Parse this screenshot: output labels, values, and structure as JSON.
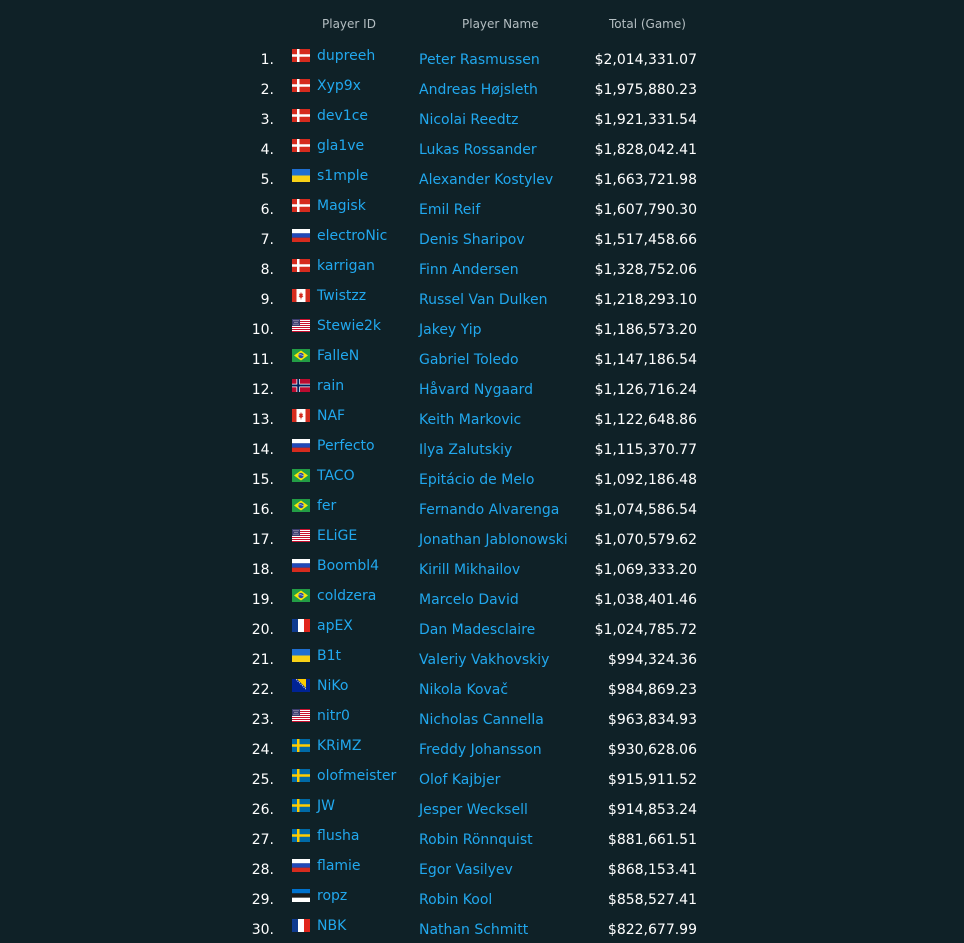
{
  "headers": {
    "player_id": "Player ID",
    "player_name": "Player Name",
    "total": "Total (Game)"
  },
  "colors": {
    "background": "#0f2127",
    "link": "#21a8ee",
    "text": "#ffffff",
    "header": "#b4bec2"
  },
  "players": [
    {
      "rank": "1.",
      "flag": "denmark-flag-icon",
      "id": "dupreeh",
      "name": "Peter Rasmussen",
      "total": "$2,014,331.07"
    },
    {
      "rank": "2.",
      "flag": "denmark-flag-icon",
      "id": "Xyp9x",
      "name": "Andreas Højsleth",
      "total": "$1,975,880.23"
    },
    {
      "rank": "3.",
      "flag": "denmark-flag-icon",
      "id": "dev1ce",
      "name": "Nicolai Reedtz",
      "total": "$1,921,331.54"
    },
    {
      "rank": "4.",
      "flag": "denmark-flag-icon",
      "id": "gla1ve",
      "name": "Lukas Rossander",
      "total": "$1,828,042.41"
    },
    {
      "rank": "5.",
      "flag": "ukraine-flag-icon",
      "id": "s1mple",
      "name": "Alexander Kostylev",
      "total": "$1,663,721.98"
    },
    {
      "rank": "6.",
      "flag": "denmark-flag-icon",
      "id": "Magisk",
      "name": "Emil Reif",
      "total": "$1,607,790.30"
    },
    {
      "rank": "7.",
      "flag": "russia-flag-icon",
      "id": "electroNic",
      "name": "Denis Sharipov",
      "total": "$1,517,458.66"
    },
    {
      "rank": "8.",
      "flag": "denmark-flag-icon",
      "id": "karrigan",
      "name": "Finn Andersen",
      "total": "$1,328,752.06"
    },
    {
      "rank": "9.",
      "flag": "canada-flag-icon",
      "id": "Twistzz",
      "name": "Russel Van Dulken",
      "total": "$1,218,293.10"
    },
    {
      "rank": "10.",
      "flag": "usa-flag-icon",
      "id": "Stewie2k",
      "name": "Jakey Yip",
      "total": "$1,186,573.20"
    },
    {
      "rank": "11.",
      "flag": "brazil-flag-icon",
      "id": "FalleN",
      "name": "Gabriel Toledo",
      "total": "$1,147,186.54"
    },
    {
      "rank": "12.",
      "flag": "norway-flag-icon",
      "id": "rain",
      "name": "Håvard Nygaard",
      "total": "$1,126,716.24"
    },
    {
      "rank": "13.",
      "flag": "canada-flag-icon",
      "id": "NAF",
      "name": "Keith Markovic",
      "total": "$1,122,648.86"
    },
    {
      "rank": "14.",
      "flag": "russia-flag-icon",
      "id": "Perfecto",
      "name": "Ilya Zalutskiy",
      "total": "$1,115,370.77"
    },
    {
      "rank": "15.",
      "flag": "brazil-flag-icon",
      "id": "TACO",
      "name": "Epitácio de Melo",
      "total": "$1,092,186.48"
    },
    {
      "rank": "16.",
      "flag": "brazil-flag-icon",
      "id": "fer",
      "name": "Fernando Alvarenga",
      "total": "$1,074,586.54"
    },
    {
      "rank": "17.",
      "flag": "usa-flag-icon",
      "id": "ELiGE",
      "name": "Jonathan Jablonowski",
      "total": "$1,070,579.62"
    },
    {
      "rank": "18.",
      "flag": "russia-flag-icon",
      "id": "Boombl4",
      "name": "Kirill Mikhailov",
      "total": "$1,069,333.20"
    },
    {
      "rank": "19.",
      "flag": "brazil-flag-icon",
      "id": "coldzera",
      "name": "Marcelo David",
      "total": "$1,038,401.46"
    },
    {
      "rank": "20.",
      "flag": "france-flag-icon",
      "id": "apEX",
      "name": "Dan Madesclaire",
      "total": "$1,024,785.72"
    },
    {
      "rank": "21.",
      "flag": "ukraine-flag-icon",
      "id": "B1t",
      "name": "Valeriy Vakhovskiy",
      "total": "$994,324.36"
    },
    {
      "rank": "22.",
      "flag": "bosnia-flag-icon",
      "id": "NiKo",
      "name": "Nikola Kovač",
      "total": "$984,869.23"
    },
    {
      "rank": "23.",
      "flag": "usa-flag-icon",
      "id": "nitr0",
      "name": "Nicholas Cannella",
      "total": "$963,834.93"
    },
    {
      "rank": "24.",
      "flag": "sweden-flag-icon",
      "id": "KRiMZ",
      "name": "Freddy Johansson",
      "total": "$930,628.06"
    },
    {
      "rank": "25.",
      "flag": "sweden-flag-icon",
      "id": "olofmeister",
      "name": "Olof Kajbjer",
      "total": "$915,911.52"
    },
    {
      "rank": "26.",
      "flag": "sweden-flag-icon",
      "id": "JW",
      "name": "Jesper Wecksell",
      "total": "$914,853.24"
    },
    {
      "rank": "27.",
      "flag": "sweden-flag-icon",
      "id": "flusha",
      "name": "Robin Rönnquist",
      "total": "$881,661.51"
    },
    {
      "rank": "28.",
      "flag": "russia-flag-icon",
      "id": "flamie",
      "name": "Egor Vasilyev",
      "total": "$868,153.41"
    },
    {
      "rank": "29.",
      "flag": "estonia-flag-icon",
      "id": "ropz",
      "name": "Robin Kool",
      "total": "$858,527.41"
    },
    {
      "rank": "30.",
      "flag": "france-flag-icon",
      "id": "NBK",
      "name": "Nathan Schmitt",
      "total": "$822,677.99"
    }
  ]
}
